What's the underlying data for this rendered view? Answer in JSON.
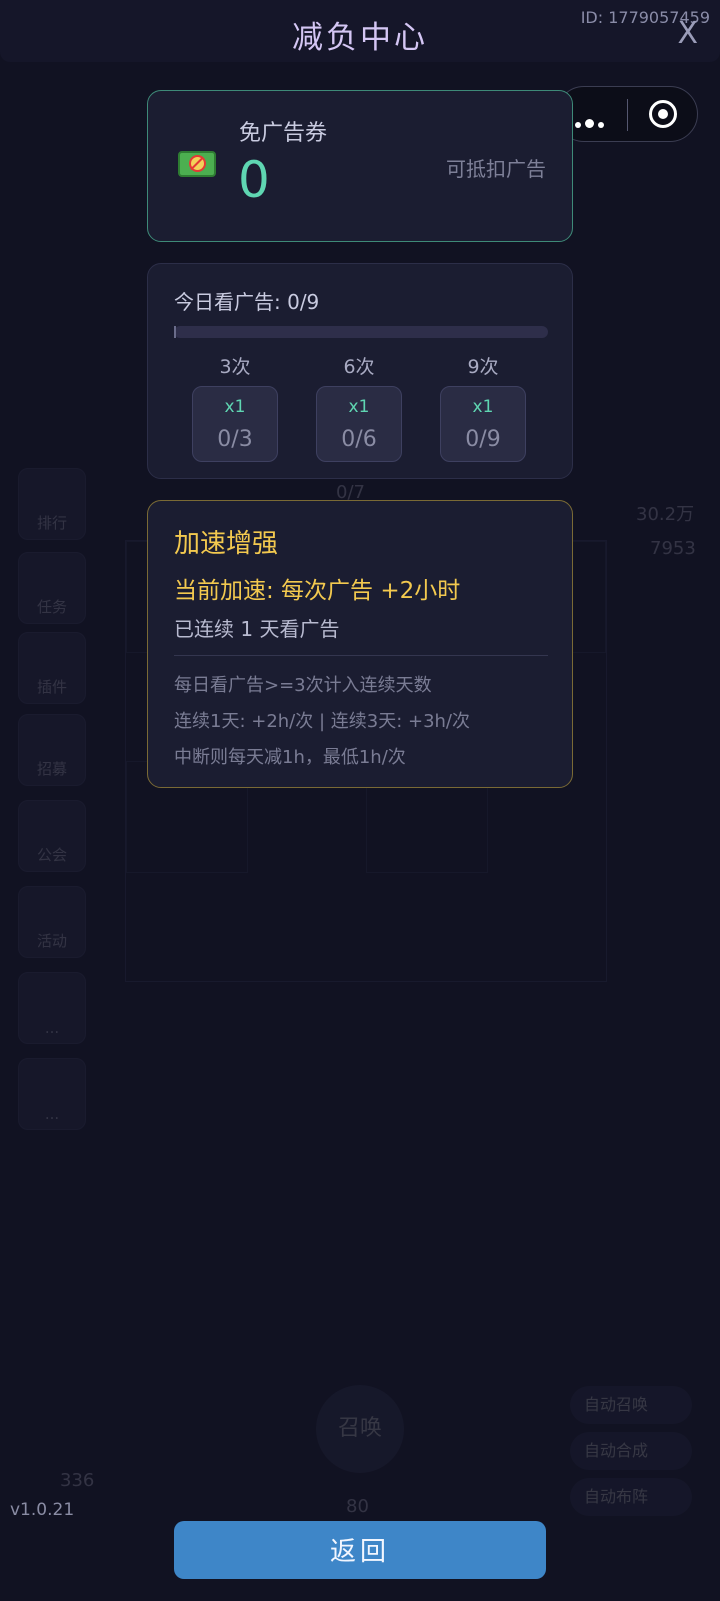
{
  "header": {
    "title": "减负中心",
    "user_id": "ID: 1779057459",
    "close_label": "X"
  },
  "ad_coupon": {
    "label": "免广告券",
    "count": "0",
    "hint": "可抵扣广告",
    "icon": "no-ad-ticket-icon"
  },
  "daily_ads": {
    "label": "今日看广告: 0/9",
    "progress": 0,
    "milestones": [
      {
        "label": "3次",
        "reward": "x1",
        "count": "0/3"
      },
      {
        "label": "6次",
        "reward": "x1",
        "count": "0/6"
      },
      {
        "label": "9次",
        "reward": "x1",
        "count": "0/9"
      }
    ]
  },
  "boost": {
    "title": "加速增强",
    "current": "当前加速: 每次广告 +2小时",
    "streak": "已连续 1 天看广告",
    "rules": [
      "每日看广告>=3次计入连续天数",
      "连续1天: +2h/次 | 连续3天: +3h/次",
      "中断则每天减1h，最低1h/次"
    ]
  },
  "version": "v1.0.21",
  "back_button": "返回",
  "background": {
    "side_buttons": [
      "排行",
      "任务",
      "插件",
      "招募",
      "公会",
      "活动",
      "...",
      "..."
    ],
    "grid_label": "0/7",
    "stat_1": "30.2万",
    "stat_2": "7953",
    "summon": "召唤",
    "summon_cost": "80",
    "gems": "336",
    "auto_toggles": [
      "自动召唤",
      "自动合成",
      "自动布阵"
    ]
  },
  "colors": {
    "accent_green": "#5fd6b2",
    "accent_gold": "#f3c94f",
    "button_blue": "#3e86c8",
    "title_purple": "#d4c6f4"
  }
}
